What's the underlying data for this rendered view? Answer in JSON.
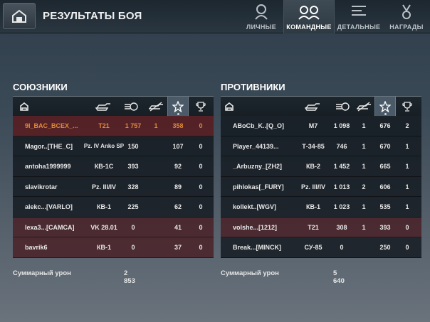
{
  "header": {
    "title": "РЕЗУЛЬТАТЫ БОЯ",
    "tabs": [
      {
        "label": "ЛИЧНЫЕ",
        "icon": "tanker-icon"
      },
      {
        "label": "КОМАНДНЫЕ",
        "icon": "team-icon"
      },
      {
        "label": "ДЕТАЛЬНЫЕ",
        "icon": "details-icon"
      },
      {
        "label": "НАГРАДЫ",
        "icon": "medal-icon"
      }
    ],
    "active_tab": 1
  },
  "allies": {
    "title": "СОЮЗНИКИ",
    "rows": [
      {
        "name": "9I_BAC_BCEX_...",
        "tank": "T21",
        "damage": "1 757",
        "kills": "1",
        "score": "358",
        "medals": "0",
        "style": "player"
      },
      {
        "name": "Magor..[THE_C]",
        "tank": "Pz. IV Anko SP",
        "damage": "150",
        "kills": "",
        "score": "107",
        "medals": "0",
        "style": "normal"
      },
      {
        "name": "antoha1999999",
        "tank": "КВ-1С",
        "damage": "393",
        "kills": "",
        "score": "92",
        "medals": "0",
        "style": "normal"
      },
      {
        "name": "slavikrotar",
        "tank": "Pz. III/IV",
        "damage": "328",
        "kills": "",
        "score": "89",
        "medals": "0",
        "style": "normal"
      },
      {
        "name": "alekc...[VARLO]",
        "tank": "КВ-1",
        "damage": "225",
        "kills": "",
        "score": "62",
        "medals": "0",
        "style": "normal"
      },
      {
        "name": "lexa3...[CAMCA]",
        "tank": "VK 28.01",
        "damage": "0",
        "kills": "",
        "score": "41",
        "medals": "0",
        "style": "hi"
      },
      {
        "name": "bavrik6",
        "tank": "КВ-1",
        "damage": "0",
        "kills": "",
        "score": "37",
        "medals": "0",
        "style": "hi"
      }
    ],
    "total_label": "Суммарный урон",
    "total_value": "2 853"
  },
  "enemies": {
    "title": "ПРОТИВНИКИ",
    "rows": [
      {
        "name": "ABoCb_K..[Q_O]",
        "tank": "M7",
        "damage": "1 098",
        "kills": "1",
        "score": "676",
        "medals": "2",
        "style": "normal"
      },
      {
        "name": "Player_44139...",
        "tank": "Т-34-85",
        "damage": "746",
        "kills": "1",
        "score": "670",
        "medals": "1",
        "style": "normal"
      },
      {
        "name": "_Arbuzny_[ZH2]",
        "tank": "КВ-2",
        "damage": "1 452",
        "kills": "1",
        "score": "665",
        "medals": "1",
        "style": "normal"
      },
      {
        "name": "pihlokas[_FURY]",
        "tank": "Pz. III/IV",
        "damage": "1 013",
        "kills": "2",
        "score": "606",
        "medals": "1",
        "style": "normal"
      },
      {
        "name": "kollekt..[WGV]",
        "tank": "КВ-1",
        "damage": "1 023",
        "kills": "1",
        "score": "535",
        "medals": "1",
        "style": "normal"
      },
      {
        "name": "volshe...[1212]",
        "tank": "T21",
        "damage": "308",
        "kills": "1",
        "score": "393",
        "medals": "0",
        "style": "hi"
      },
      {
        "name": "Break...[MINCK]",
        "tank": "СУ-85",
        "damage": "0",
        "kills": "",
        "score": "250",
        "medals": "0",
        "style": "normal"
      }
    ],
    "total_label": "Суммарный урон",
    "total_value": "5 640"
  }
}
